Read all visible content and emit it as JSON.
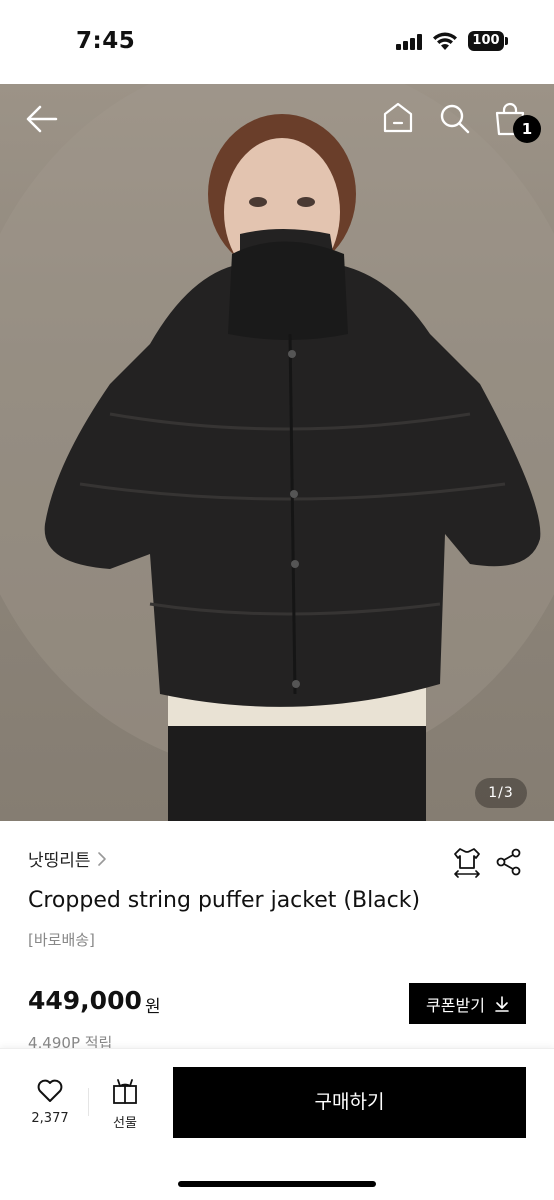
{
  "status_bar": {
    "time": "7:45",
    "battery": "100"
  },
  "hero": {
    "page_indicator": "1/3",
    "cart_count": "1"
  },
  "product": {
    "brand": "낫띵리튼",
    "title": "Cropped string puffer jacket (Black)",
    "shipping_tag": "[바로배송]",
    "price": "449,000",
    "price_unit": "원",
    "coupon_label": "쿠폰받기",
    "points": "4,490P 적립"
  },
  "bottom_bar": {
    "like_count": "2,377",
    "gift_label": "선물",
    "buy_label": "구매하기"
  },
  "icons": [
    "back-arrow-icon",
    "home-icon",
    "search-icon",
    "shopping-bag-icon",
    "chevron-right-icon",
    "size-guide-icon",
    "share-icon",
    "download-icon",
    "heart-icon",
    "gift-icon"
  ],
  "colors": {
    "primary": "#000000",
    "background": "#ffffff",
    "muted_text": "#888888"
  }
}
